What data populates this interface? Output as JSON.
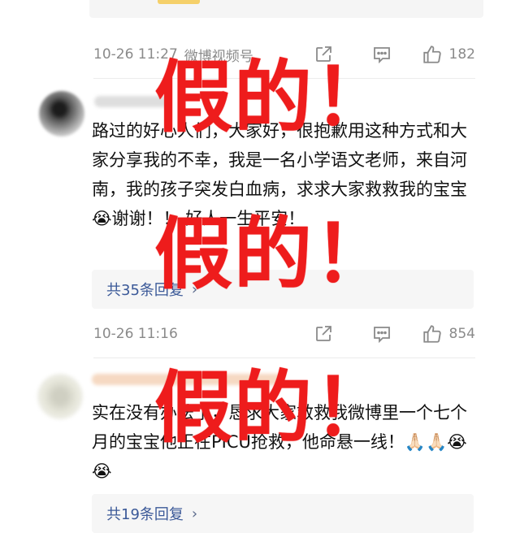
{
  "comments": [
    {
      "meta": {
        "time": "10-26 11:27",
        "source": "微博视频号",
        "likes": "182"
      }
    },
    {
      "text": "路过的好心人们，大家好，很抱歉用这种方式和大家分享我的不幸，我是一名小学语文老师，来自河南，我的孩子突发白血病，求求大家救救我的宝宝😭谢谢！！ 好人一生平安！",
      "replies_label": "共35条回复",
      "meta": {
        "time": "10-26 11:16",
        "source": "",
        "likes": "854"
      }
    },
    {
      "text": "实在没有办法了，恳求大家救救我微博里一个七个月的宝宝他正在PICU抢救，他命悬一线！🙏🏻🙏🏻😭😭",
      "replies_label": "共19条回复"
    }
  ],
  "overlay": {
    "stamp_text": "假的！"
  },
  "colors": {
    "stamp": "#ee1c1c",
    "link": "#3b5998",
    "meta_gray": "#8a8a8a"
  }
}
